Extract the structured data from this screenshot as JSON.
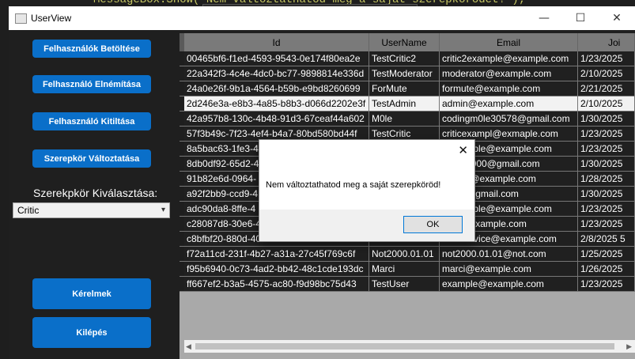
{
  "ide": {
    "code_snippet": "MessageBox.Show(\"Nem változtathatod meg a saját szerepkörödet!\");"
  },
  "toolbar_icons": [
    "select-element-icon",
    "video-icon",
    "track-focus-icon",
    "layout-adorner-icon",
    "hot-reload-icon",
    "accessibility-icon",
    "collapse-icon",
    "check-icon",
    "chevron-left-icon"
  ],
  "window": {
    "title": "UserView",
    "minimize": "—",
    "maximize": "☐",
    "close": "✕"
  },
  "sidebar": {
    "load_users": "Felhasználók Betöltése",
    "hide_user": "Felhasználó Elnémítása",
    "ban_user": "Felhasználó Kitiltása",
    "change_role": "Szerepkör Változtatása",
    "role_label": "Szerekpkör Kiválasztása:",
    "role_value": "Critic",
    "requests": "Kérelmek",
    "exit": "Kilépés"
  },
  "grid": {
    "columns": [
      "Id",
      "UserName",
      "Email",
      "Joi"
    ],
    "rows": [
      [
        "00465bf6-f1ed-4593-9543-0e174f80ea2e",
        "TestCritic2",
        "critic2example@example.com",
        "1/23/2025"
      ],
      [
        "22a342f3-4c4e-4dc0-bc77-9898814e336d",
        "TestModerator",
        "moderator@example.com",
        "2/10/2025"
      ],
      [
        "24a0e26f-9b1a-4564-b59b-e9bd8260699",
        "ForMute",
        "formute@example.com",
        "2/21/2025"
      ],
      [
        "2d246e3a-e8b3-4a85-b8b3-d066d2202e3f",
        "TestAdmin",
        "admin@example.com",
        "2/10/2025"
      ],
      [
        "42a957b8-130c-4b48-91d3-67ceaf44a602",
        "M0le",
        "codingm0le30578@gmail.com",
        "1/30/2025"
      ],
      [
        "57f3b49c-7f23-4ef4-b4a7-80bd580bd44f",
        "TestCritic",
        "criticexampl@exmaple.com",
        "1/23/2025"
      ],
      [
        "8a5bac63-1fe3-4",
        "",
        "...exmaple@example.com",
        "1/23/2025"
      ],
      [
        "8db0df92-65d2-4",
        "",
        "...0000000@gmail.com",
        "1/30/2025"
      ],
      [
        "91b82e6d-0964-",
        "",
        "...ezso@example.com",
        "1/28/2025"
      ],
      [
        "a92f2bb9-ccd9-4",
        "",
        "...863@gmail.com",
        "1/30/2025"
      ],
      [
        "adc90da8-8ffe-4",
        "",
        "...exmaple@example.com",
        "1/23/2025"
      ],
      [
        "c28087d8-30e6-4",
        "",
        "...e2@example.com",
        "1/23/2025"
      ],
      [
        "c8bfbf20-880d-4029-8e6c-ec09207d39a",
        "AuthService123",
        "authservice@example.com",
        "2/8/2025 5"
      ],
      [
        "f72a11cd-231f-4b27-a31a-27c45f769c6f",
        "Not2000.01.01",
        "not2000.01.01@not.com",
        "1/25/2025"
      ],
      [
        "f95b6940-0c73-4ad2-bb42-48c1cde193dc",
        "Marci",
        "marci@example.com",
        "1/26/2025"
      ],
      [
        "ff667ef2-b3a5-4575-ac80-f9d98bc75d43",
        "TestUser",
        "example@example.com",
        "1/23/2025"
      ]
    ]
  },
  "dialog": {
    "message": "Nem változtathatod meg a saját szerepköröd!",
    "ok": "OK",
    "close": "✕"
  }
}
